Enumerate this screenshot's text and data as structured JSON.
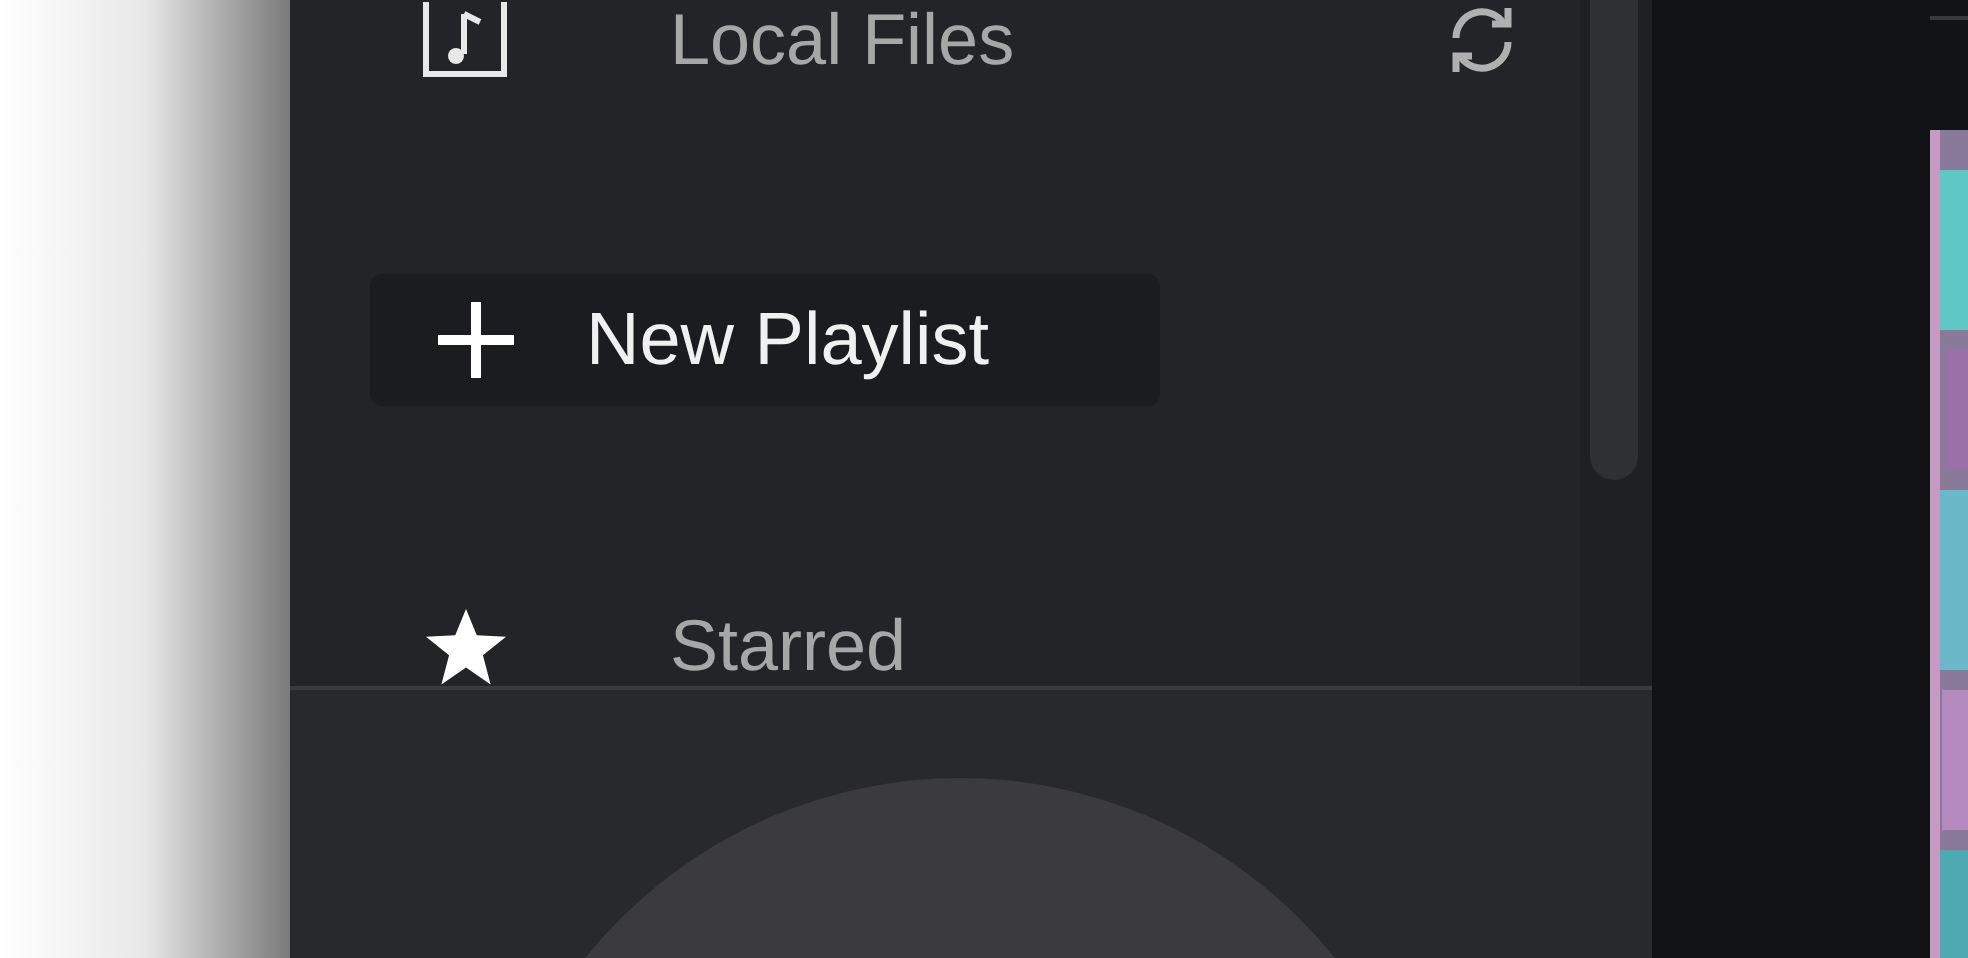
{
  "sidebar": {
    "local_files": {
      "label": "Local Files"
    },
    "new_playlist": {
      "label": "New Playlist"
    },
    "starred": {
      "label": "Starred"
    }
  }
}
